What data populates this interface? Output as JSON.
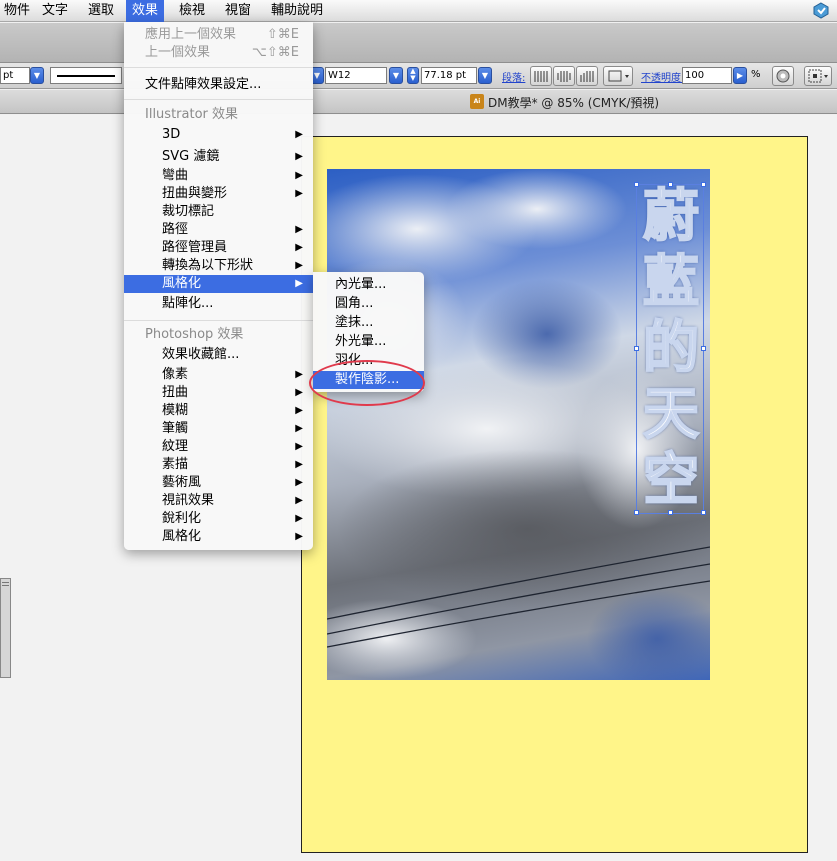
{
  "menubar": {
    "items": [
      "物件",
      "文字",
      "選取",
      "效果",
      "檢視",
      "視窗",
      "輔助說明"
    ],
    "active": "效果"
  },
  "controlbar": {
    "stroke_unit": "pt",
    "font_field": "W12",
    "size_field": "77.18 pt",
    "paragraph_label": "段落:",
    "opacity_label": "不透明度:",
    "opacity_value": "100",
    "percent": "%"
  },
  "document": {
    "title": "DM教學* @ 85% (CMYK/預視)",
    "icon_label": "Ai"
  },
  "artwork": {
    "headline_chars": [
      "蔚",
      "藍",
      "的",
      "天",
      "空"
    ]
  },
  "effect_menu": {
    "apply_last": {
      "label": "應用上一個效果",
      "shortcut": "⇧⌘E"
    },
    "last_effect": {
      "label": "上一個效果",
      "shortcut": "⌥⇧⌘E"
    },
    "doc_raster": "文件點陣效果設定...",
    "illustrator_header": "Illustrator 效果",
    "illustrator_items": [
      {
        "label": "3D",
        "sub": true
      },
      {
        "label": "SVG 濾鏡",
        "sub": true
      },
      {
        "label": "彎曲",
        "sub": true
      },
      {
        "label": "扭曲與變形",
        "sub": true
      },
      {
        "label": "裁切標記",
        "sub": false
      },
      {
        "label": "路徑",
        "sub": true
      },
      {
        "label": "路徑管理員",
        "sub": true
      },
      {
        "label": "轉換為以下形狀",
        "sub": true
      },
      {
        "label": "風格化",
        "sub": true,
        "highlight": true
      },
      {
        "label": "點陣化...",
        "sub": false
      }
    ],
    "photoshop_header": "Photoshop 效果",
    "photoshop_items": [
      {
        "label": "效果收藏館...",
        "sub": false
      },
      {
        "label": "像素",
        "sub": true
      },
      {
        "label": "扭曲",
        "sub": true
      },
      {
        "label": "模糊",
        "sub": true
      },
      {
        "label": "筆觸",
        "sub": true
      },
      {
        "label": "紋理",
        "sub": true
      },
      {
        "label": "素描",
        "sub": true
      },
      {
        "label": "藝術風",
        "sub": true
      },
      {
        "label": "視訊效果",
        "sub": true
      },
      {
        "label": "銳利化",
        "sub": true
      },
      {
        "label": "風格化",
        "sub": true
      }
    ]
  },
  "stylize_submenu": {
    "items": [
      "內光暈...",
      "圓角...",
      "塗抹...",
      "外光暈...",
      "羽化...",
      "製作陰影..."
    ],
    "highlighted": "製作陰影..."
  },
  "colors": {
    "accent": "#3c6de2",
    "artboard": "#fff589",
    "annotation": "#e03a4c"
  }
}
